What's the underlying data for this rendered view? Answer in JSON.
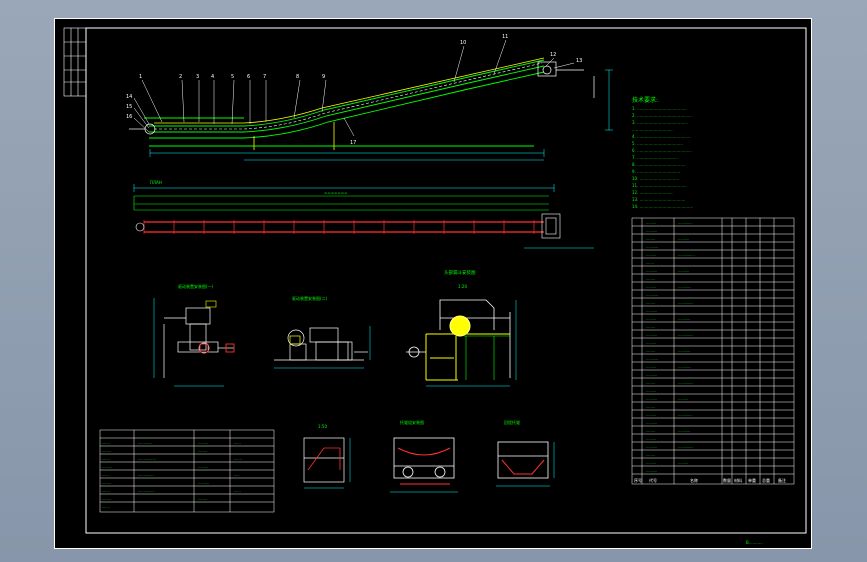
{
  "drawing": {
    "footer_title": "B...........",
    "scale_a": "1:20",
    "scale_b": "1:50",
    "table_header": [
      "序号",
      "代号",
      "名称",
      "数量",
      "材料",
      "单重",
      "总重",
      "备注"
    ]
  },
  "colors": {
    "paper": "#000000",
    "border": "#ffffff",
    "structure": "#00ff00",
    "conveyor": "#ffff00",
    "belt": "#ff3030",
    "dimension": "#00ffff"
  }
}
